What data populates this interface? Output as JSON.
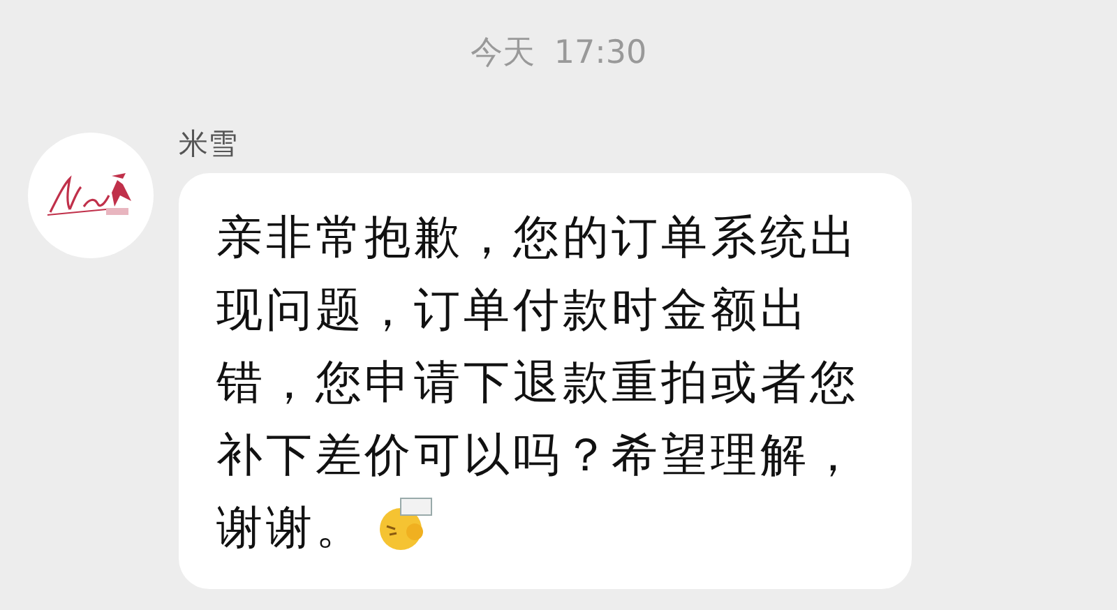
{
  "timestamp": {
    "day": "今天",
    "time": "17:30"
  },
  "messages": [
    {
      "sender": "米雪",
      "text": "亲非常抱歉，您的订单系统出现问题，订单付款时金额出错，您申请下退款重拍或者您补下差价可以吗？希望理解，谢谢。"
    }
  ]
}
